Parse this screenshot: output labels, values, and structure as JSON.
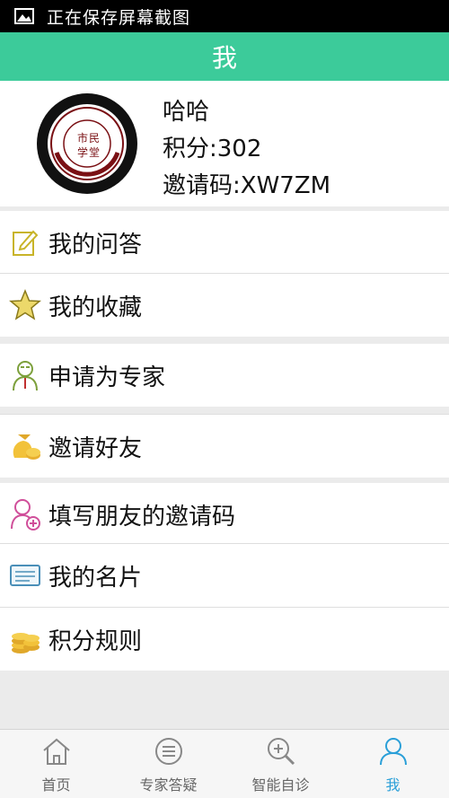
{
  "status_bar": {
    "text": "正在保存屏幕截图",
    "icon": "image-icon"
  },
  "header": {
    "title": "我"
  },
  "profile": {
    "name": "哈哈",
    "points": "积分:302",
    "invite_code": "邀请码:XW7ZM",
    "avatar_icon": "school-logo-icon"
  },
  "menu": {
    "my_questions": "我的问答",
    "my_favorites": "我的收藏",
    "apply_expert": "申请为专家",
    "invite_friends": "邀请好友",
    "enter_friend_code": "填写朋友的邀请码",
    "my_card": "我的名片",
    "points_rules": "积分规则"
  },
  "bottom_nav": {
    "home": "首页",
    "expert_qa": "专家答疑",
    "self_diagnosis": "智能自诊",
    "me": "我",
    "active": "me",
    "active_color": "#2a9fd8"
  },
  "colors": {
    "header_bg": "#3ccb9a",
    "page_bg": "#ebebeb"
  }
}
